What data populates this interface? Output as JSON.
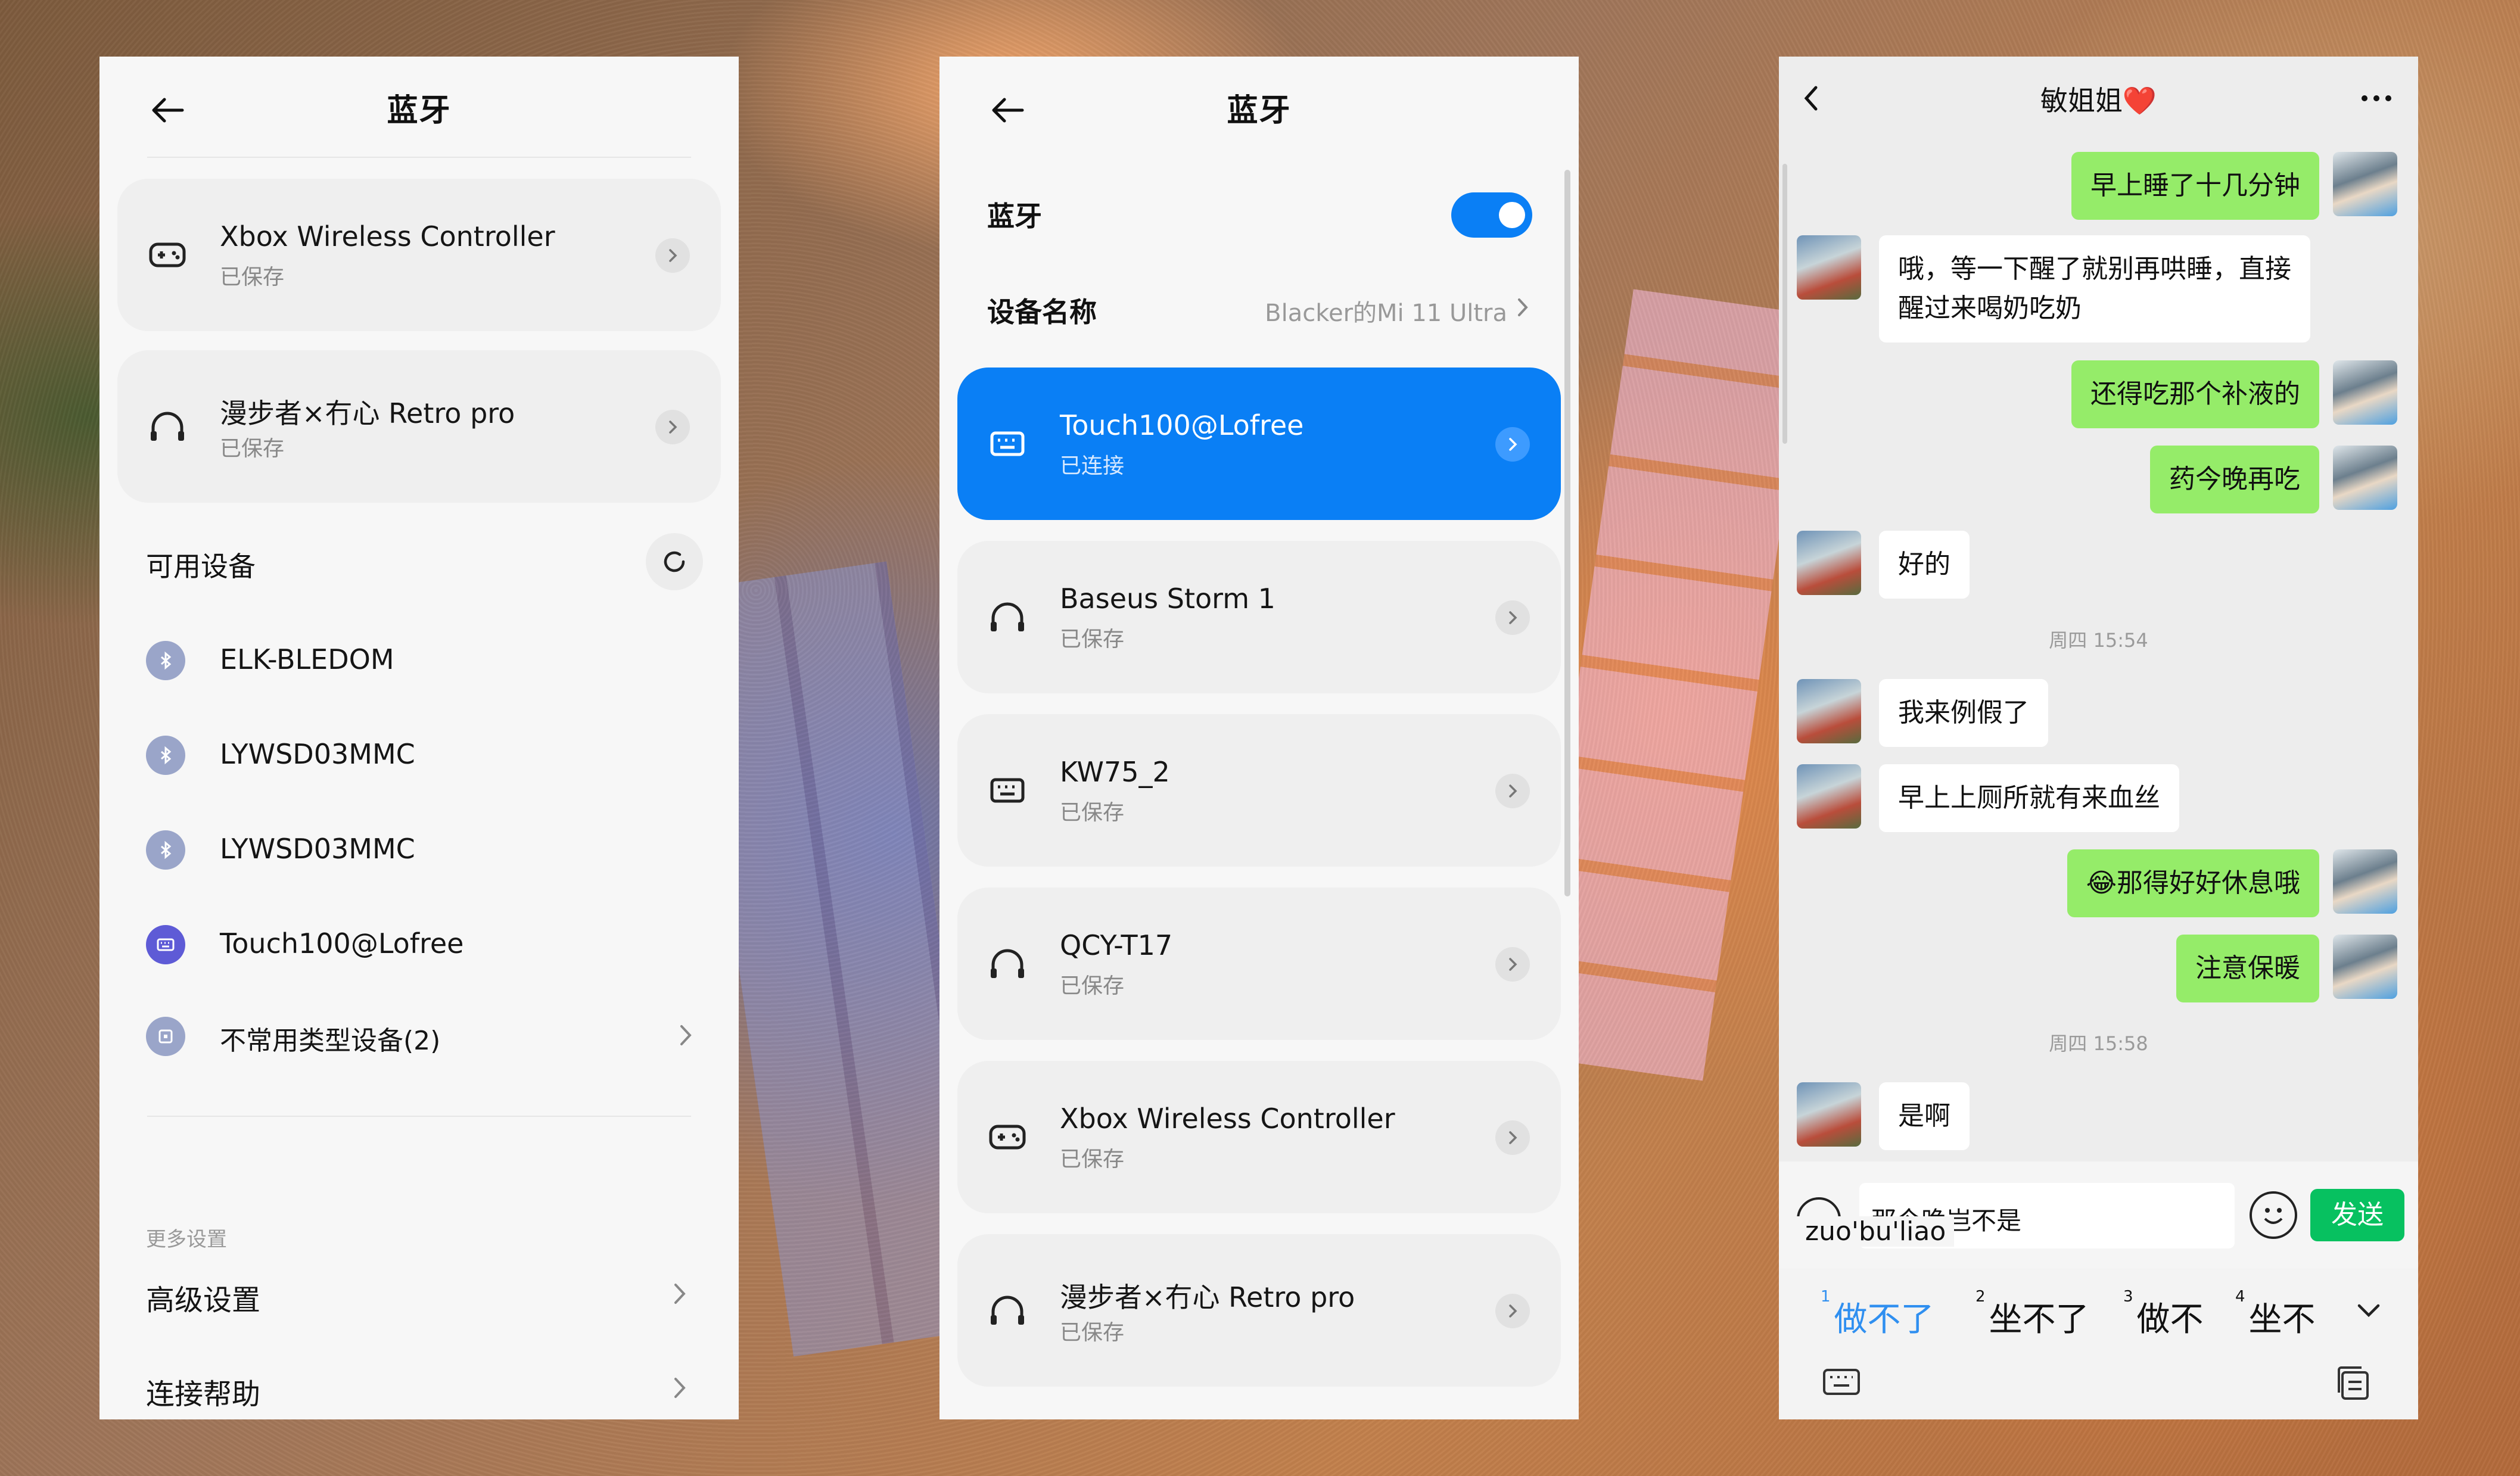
{
  "panel1": {
    "title": "蓝牙",
    "saved_devices": [
      {
        "name": "Xbox Wireless Controller",
        "status": "已保存",
        "icon": "gamepad-icon"
      },
      {
        "name": "漫步者×冇心 Retro pro",
        "status": "已保存",
        "icon": "headphones-icon"
      }
    ],
    "available_label": "可用设备",
    "available": [
      {
        "name": "ELK-BLEDOM",
        "icon": "bluetooth-icon"
      },
      {
        "name": "LYWSD03MMC",
        "icon": "bluetooth-icon"
      },
      {
        "name": "LYWSD03MMC",
        "icon": "bluetooth-icon"
      },
      {
        "name": "Touch100@Lofree",
        "icon": "keyboard-icon"
      }
    ],
    "uncommon": "不常用类型设备(2)",
    "more_settings": "更多设置",
    "advanced": "高级设置",
    "help": "连接帮助"
  },
  "panel2": {
    "title": "蓝牙",
    "toggle_label": "蓝牙",
    "toggle_on": true,
    "device_name_label": "设备名称",
    "device_name_value": "Blacker的Mi 11 Ultra",
    "devices": [
      {
        "name": "Touch100@Lofree",
        "status": "已连接",
        "icon": "keyboard-icon",
        "active": true
      },
      {
        "name": "Baseus Storm 1",
        "status": "已保存",
        "icon": "headphones-icon"
      },
      {
        "name": "KW75_2",
        "status": "已保存",
        "icon": "keyboard-icon"
      },
      {
        "name": "QCY-T17",
        "status": "已保存",
        "icon": "headphones-icon"
      },
      {
        "name": "Xbox Wireless Controller",
        "status": "已保存",
        "icon": "gamepad-icon"
      },
      {
        "name": "漫步者×冇心 Retro pro",
        "status": "已保存",
        "icon": "headphones-icon"
      }
    ]
  },
  "chat": {
    "title": "敏姐姐❤️",
    "messages": [
      {
        "side": "out",
        "text": "早上睡了十几分钟"
      },
      {
        "side": "in",
        "text": "哦，等一下醒了就别再哄睡，直接",
        "text2": "醒过来喝奶吃奶"
      },
      {
        "side": "out",
        "text": "还得吃那个补液的"
      },
      {
        "side": "out",
        "text": "药今晚再吃"
      },
      {
        "side": "in",
        "text": "好的"
      },
      {
        "time": "周四 15:54"
      },
      {
        "side": "in",
        "text": "我来例假了"
      },
      {
        "side": "in",
        "text": "早上上厕所就有来血丝"
      },
      {
        "side": "out",
        "text": "😂那得好好休息哦"
      },
      {
        "side": "out",
        "text": "注意保暖"
      },
      {
        "time": "周四 15:58"
      },
      {
        "side": "in",
        "text": "是啊"
      }
    ],
    "input_text": "那今晚岂不是",
    "pinyin": "zuo'bu'liao",
    "send_label": "发送",
    "candidates": [
      {
        "num": "1",
        "text": "做不了"
      },
      {
        "num": "2",
        "text": "坐不了"
      },
      {
        "num": "3",
        "text": "做不"
      },
      {
        "num": "4",
        "text": "坐不"
      }
    ]
  },
  "colors": {
    "accent": "#0a7ff5",
    "wechat_green": "#95ec69",
    "send_green": "#07c160"
  }
}
